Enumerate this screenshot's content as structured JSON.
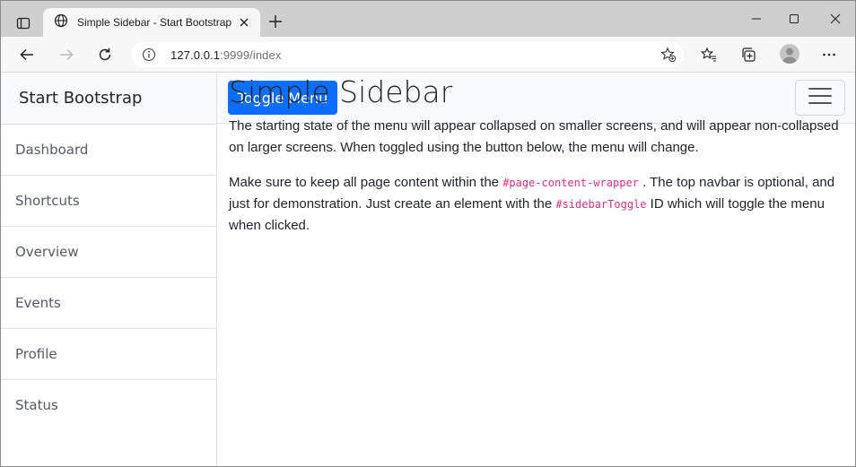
{
  "browser": {
    "tab_title": "Simple Sidebar - Start Bootstrap",
    "url_host": "127.0.0.1",
    "url_rest": ":9999/index"
  },
  "sidebar": {
    "heading": "Start Bootstrap",
    "items": [
      {
        "label": "Dashboard"
      },
      {
        "label": "Shortcuts"
      },
      {
        "label": "Overview"
      },
      {
        "label": "Events"
      },
      {
        "label": "Profile"
      },
      {
        "label": "Status"
      }
    ]
  },
  "topnav": {
    "toggle_label": "Toggle Menu"
  },
  "content": {
    "title": "Simple Sidebar",
    "p1": "The starting state of the menu will appear collapsed on smaller screens, and will appear non-collapsed on larger screens. When toggled using the button below, the menu will change.",
    "p2_a": "Make sure to keep all page content within the ",
    "p2_code1": "#page-content-wrapper",
    "p2_b": ". The top navbar is optional, and just for demonstration. Just create an element with the ",
    "p2_code2": "#sidebarToggle",
    "p2_c": " ID which will toggle the menu when clicked."
  },
  "colors": {
    "primary": "#0d6efd",
    "code": "#d63384",
    "sidebar_bg": "#f8f9fa",
    "border": "#dee2e6"
  },
  "icons": [
    "tab-actions-icon",
    "globe-icon",
    "close-icon",
    "plus-icon",
    "minimize-icon",
    "maximize-icon",
    "window-close-icon",
    "back-icon",
    "forward-icon",
    "refresh-icon",
    "info-icon",
    "add-favorite-icon",
    "favorites-icon",
    "collections-icon",
    "profile-icon",
    "more-icon",
    "hamburger-icon"
  ]
}
